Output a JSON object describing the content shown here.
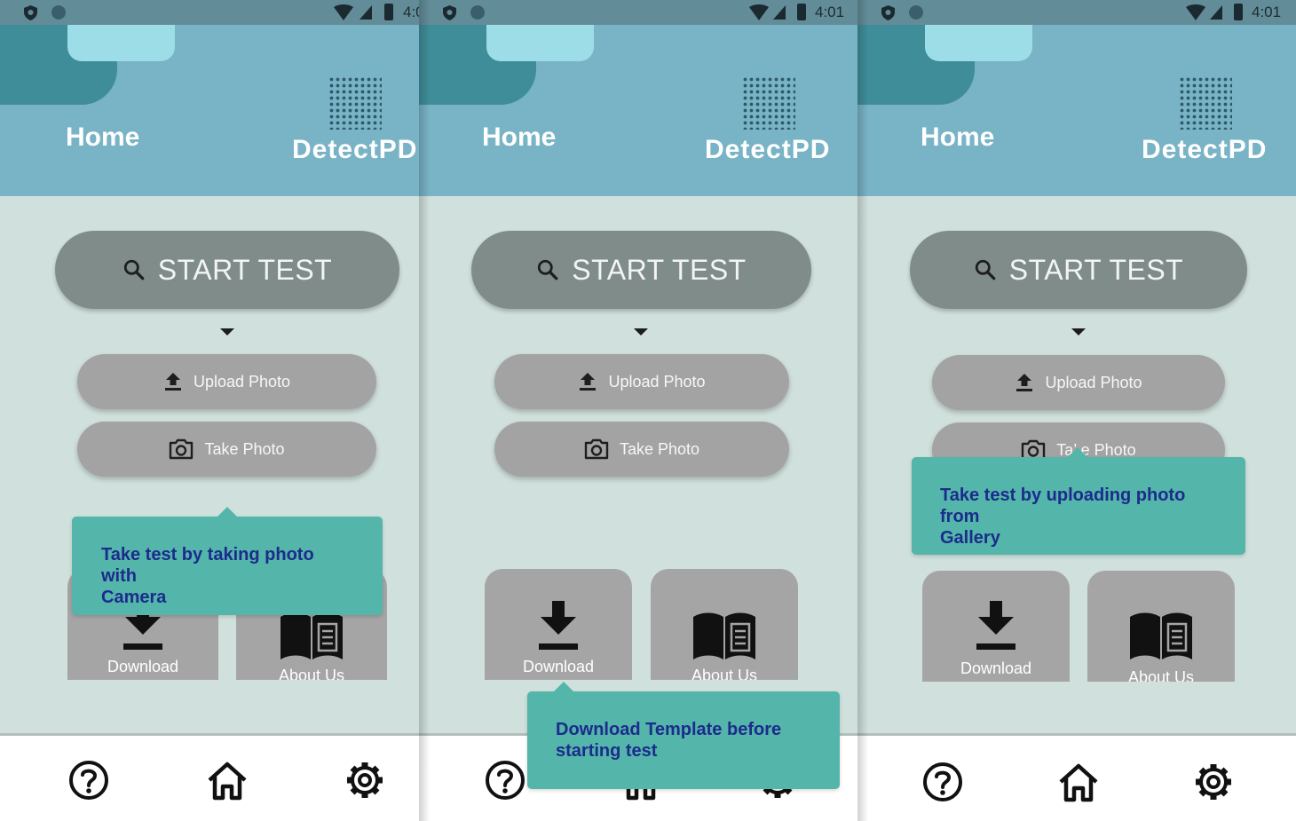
{
  "status_bar": {
    "time": "4:01"
  },
  "header": {
    "title": "Home",
    "brand": "DetectPD"
  },
  "actions": {
    "start_test": "START TEST",
    "upload_photo": "Upload Photo",
    "take_photo": "Take Photo",
    "take_photo_partial": "Ta’ e Photo"
  },
  "cards": {
    "download": "Download",
    "about_us": "About Us"
  },
  "tooltips": {
    "camera_line1": "Take test by taking photo with",
    "camera_line2": "Camera",
    "download_line1": "Download Template before",
    "download_line2": "starting test",
    "gallery_line1": "Take test by uploading photo from",
    "gallery_line2": "Gallery"
  },
  "icons": {
    "status": [
      "shield-icon",
      "circle-icon",
      "wifi-icon",
      "cell-signal-icon",
      "battery-icon"
    ],
    "start": "search-icon",
    "upload": "upload-icon",
    "take": "camera-icon",
    "download": "download-icon",
    "about": "book-icon",
    "nav": [
      "help-icon",
      "home-icon",
      "settings-icon"
    ]
  },
  "colors": {
    "header": "#79b3c6",
    "background": "#d0e0dc",
    "start_button": "#808c8a",
    "pill_button": "#a3a3a3",
    "card": "#a5a5a5",
    "tooltip": "#54b5aa",
    "tooltip_text": "#1c2b8c"
  }
}
